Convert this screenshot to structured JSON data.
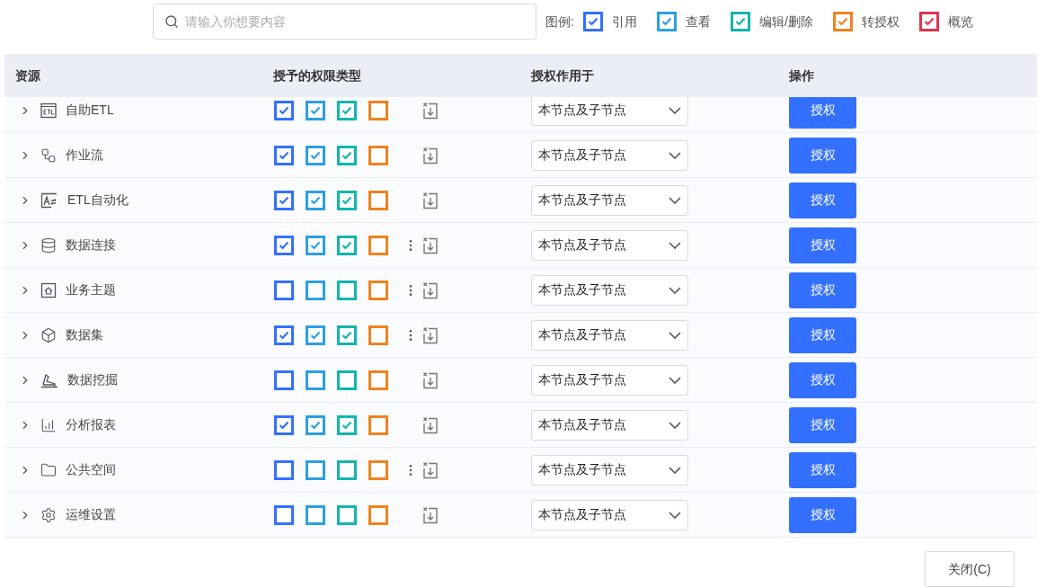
{
  "search": {
    "placeholder": "请输入你想要内容"
  },
  "legend": {
    "label": "图例:",
    "items": [
      {
        "label": "引用",
        "color": "#3370ff",
        "checked": true
      },
      {
        "label": "查看",
        "color": "#2b9fe3",
        "checked": true
      },
      {
        "label": "编辑/删除",
        "color": "#12b5b0",
        "checked": true
      },
      {
        "label": "转授权",
        "color": "#f0821e",
        "checked": true
      },
      {
        "label": "概览",
        "color": "#e0344f",
        "checked": true
      }
    ]
  },
  "table": {
    "columns": [
      "资源",
      "授予的权限类型",
      "授权作用于",
      "操作"
    ],
    "rows": [
      {
        "name": "自助ETL",
        "perms": [
          {
            "checked": true
          },
          {
            "checked": true
          },
          {
            "checked": true
          },
          {
            "checked": false
          }
        ],
        "more_menu": false,
        "scope": "本节点及子节点",
        "action": "授权"
      },
      {
        "name": "作业流",
        "perms": [
          {
            "checked": true
          },
          {
            "checked": true
          },
          {
            "checked": true
          },
          {
            "checked": false
          }
        ],
        "more_menu": false,
        "scope": "本节点及子节点",
        "action": "授权"
      },
      {
        "name": "ETL自动化",
        "perms": [
          {
            "checked": true
          },
          {
            "checked": true
          },
          {
            "checked": true
          },
          {
            "checked": false
          }
        ],
        "more_menu": false,
        "scope": "本节点及子节点",
        "action": "授权"
      },
      {
        "name": "数据连接",
        "perms": [
          {
            "checked": true
          },
          {
            "checked": true
          },
          {
            "checked": true
          },
          {
            "checked": false
          }
        ],
        "more_menu": true,
        "scope": "本节点及子节点",
        "action": "授权"
      },
      {
        "name": "业务主题",
        "perms": [
          {
            "checked": false
          },
          {
            "checked": false
          },
          {
            "checked": false
          },
          {
            "checked": false
          }
        ],
        "more_menu": true,
        "scope": "本节点及子节点",
        "action": "授权"
      },
      {
        "name": "数据集",
        "perms": [
          {
            "checked": true
          },
          {
            "checked": true
          },
          {
            "checked": true
          },
          {
            "checked": false
          }
        ],
        "more_menu": true,
        "scope": "本节点及子节点",
        "action": "授权"
      },
      {
        "name": "数据挖掘",
        "perms": [
          {
            "checked": false
          },
          {
            "checked": false
          },
          {
            "checked": false
          },
          {
            "checked": false
          }
        ],
        "more_menu": false,
        "scope": "本节点及子节点",
        "action": "授权"
      },
      {
        "name": "分析报表",
        "perms": [
          {
            "checked": true
          },
          {
            "checked": true
          },
          {
            "checked": true
          },
          {
            "checked": false
          }
        ],
        "more_menu": false,
        "scope": "本节点及子节点",
        "action": "授权"
      },
      {
        "name": "公共空间",
        "perms": [
          {
            "checked": false
          },
          {
            "checked": false
          },
          {
            "checked": false
          },
          {
            "checked": false
          }
        ],
        "more_menu": true,
        "scope": "本节点及子节点",
        "action": "授权"
      },
      {
        "name": "运维设置",
        "perms": [
          {
            "checked": false
          },
          {
            "checked": false
          },
          {
            "checked": false
          },
          {
            "checked": false
          }
        ],
        "more_menu": false,
        "scope": "本节点及子节点",
        "action": "授权"
      }
    ]
  },
  "footer": {
    "close_button": "关闭(C)"
  }
}
